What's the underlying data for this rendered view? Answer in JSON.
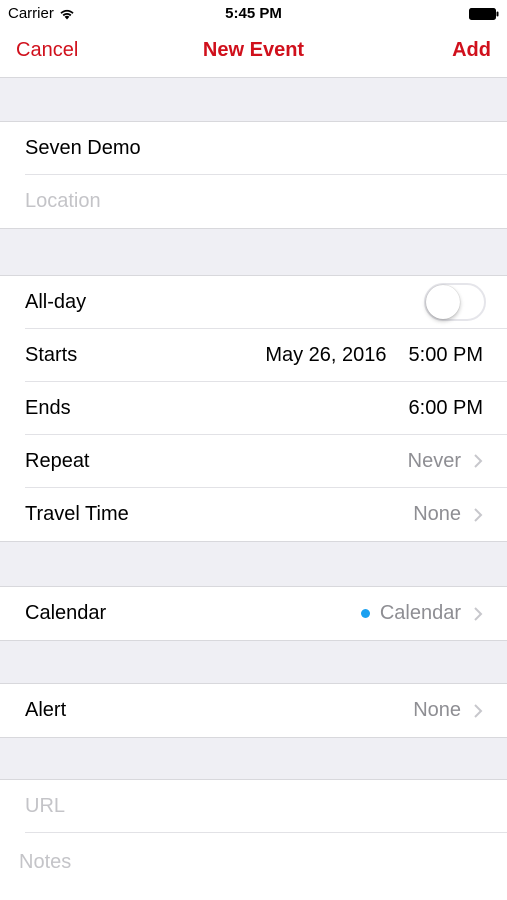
{
  "status": {
    "carrier": "Carrier",
    "time": "5:45 PM"
  },
  "nav": {
    "cancel": "Cancel",
    "title": "New Event",
    "add": "Add"
  },
  "event": {
    "title": "Seven Demo",
    "location_placeholder": "Location"
  },
  "schedule": {
    "allday_label": "All-day",
    "allday_on": false,
    "starts_label": "Starts",
    "starts_date": "May 26, 2016",
    "starts_time": "5:00 PM",
    "ends_label": "Ends",
    "ends_time": "6:00 PM",
    "repeat_label": "Repeat",
    "repeat_value": "Never",
    "travel_label": "Travel Time",
    "travel_value": "None"
  },
  "calendar": {
    "label": "Calendar",
    "value": "Calendar",
    "dot_color": "#1aa0f0"
  },
  "alert": {
    "label": "Alert",
    "value": "None"
  },
  "extra": {
    "url_placeholder": "URL",
    "notes_placeholder": "Notes"
  },
  "colors": {
    "accent": "#d0101c",
    "secondary_text": "#8e8e93",
    "background": "#efeff4"
  }
}
